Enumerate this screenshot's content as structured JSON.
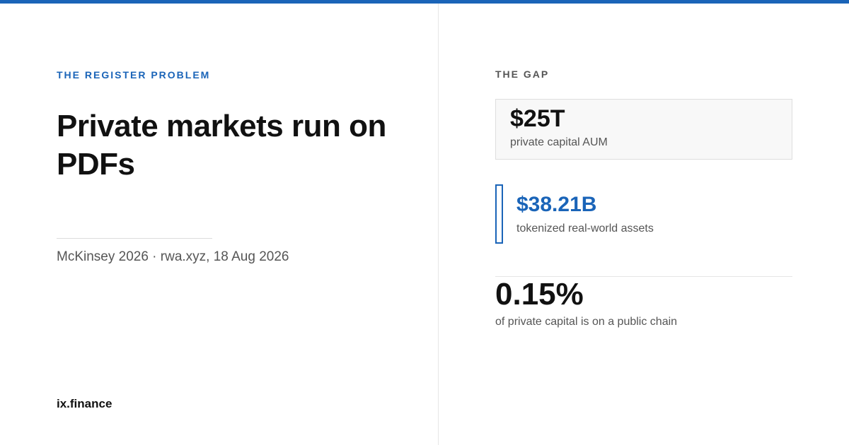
{
  "colors": {
    "accent": "#1a64b8",
    "text": "#111111",
    "muted": "#555555"
  },
  "left": {
    "eyebrow": "THE REGISTER PROBLEM",
    "headline": "Private markets run on PDFs",
    "source": "McKinsey 2026 · rwa.xyz, 18 Aug 2026",
    "brand": "ix.finance"
  },
  "right": {
    "eyebrow": "THE GAP",
    "stats": [
      {
        "value": "$25T",
        "label": "private capital AUM"
      },
      {
        "value": "$38.21B",
        "label": "tokenized real-world assets"
      },
      {
        "value": "0.15%",
        "label": "of private capital is on a public chain"
      }
    ]
  }
}
